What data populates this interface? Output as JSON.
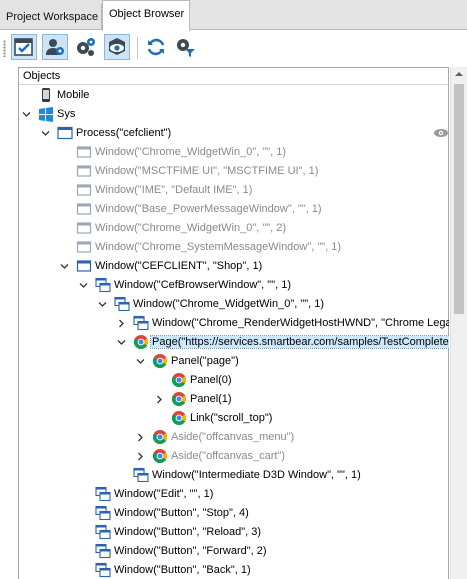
{
  "tabs": [
    {
      "label": "Project Workspace",
      "active": false
    },
    {
      "label": "Object Browser",
      "active": true
    }
  ],
  "toolbar": {
    "buttons": [
      {
        "name": "checklist-icon",
        "pressed": true
      },
      {
        "name": "user-settings-icon",
        "pressed": true
      },
      {
        "name": "gears-icon",
        "pressed": false
      },
      {
        "name": "eye-box-icon",
        "pressed": true
      },
      {
        "name": "refresh-icon",
        "pressed": false
      },
      {
        "name": "gear-filter-icon",
        "pressed": false
      }
    ]
  },
  "panel": {
    "header": "Objects"
  },
  "tree": {
    "mobile": "Mobile",
    "sys": "Sys",
    "process": "Process(\"cefclient\")",
    "w_widgetwin0_1": "Window(\"Chrome_WidgetWin_0\", \"\", 1)",
    "w_msctfime": "Window(\"MSCTFIME UI\", \"MSCTFIME UI\", 1)",
    "w_ime": "Window(\"IME\", \"Default IME\", 1)",
    "w_powermsg": "Window(\"Base_PowerMessageWindow\", \"\", 1)",
    "w_widgetwin0_2": "Window(\"Chrome_WidgetWin_0\", \"\", 2)",
    "w_sysmsg": "Window(\"Chrome_SystemMessageWindow\", \"\", 1)",
    "w_cefclient": "Window(\"CEFCLIENT\", \"Shop\", 1)",
    "w_cefbrowser": "Window(\"CefBrowserWindow\", \"\", 1)",
    "w_widgetwin0_inner": "Window(\"Chrome_WidgetWin_0\", \"\", 1)",
    "w_renderhost": "Window(\"Chrome_RenderWidgetHostHWND\", \"Chrome Legacy",
    "page": "Page(\"https://services.smartbear.com/samples/TestComplete",
    "panel_page": "Panel(\"page\")",
    "panel0": "Panel(0)",
    "panel1": "Panel(1)",
    "link_scroll": "Link(\"scroll_top\")",
    "aside_menu": "Aside(\"offcanvas_menu\")",
    "aside_cart": "Aside(\"offcanvas_cart\")",
    "w_d3d": "Window(\"Intermediate D3D Window\", \"\", 1)",
    "w_edit": "Window(\"Edit\", \"\", 1)",
    "w_stop": "Window(\"Button\", \"Stop\", 4)",
    "w_reload": "Window(\"Button\", \"Reload\", 3)",
    "w_forward": "Window(\"Button\", \"Forward\", 2)",
    "w_back": "Window(\"Button\", \"Back\", 1)"
  },
  "colors": {
    "selection": "#cce8ff",
    "dim_text": "#8a8a8a",
    "toolbar_blue": "#1e6fb8",
    "toolbar_dark": "#3c4a57"
  }
}
